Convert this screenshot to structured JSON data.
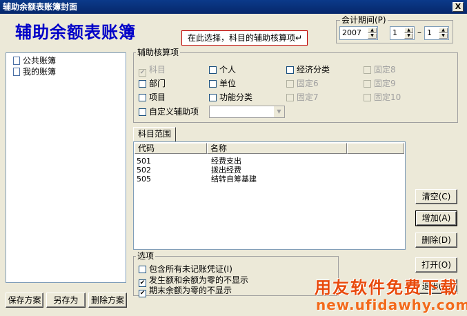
{
  "window": {
    "title": "辅助余额表账簿封面",
    "close_label": "X"
  },
  "heading": "辅助余额表账簿",
  "hint": "在此选择，科目的辅助核算项↵",
  "period": {
    "label": "会计期间(P)",
    "year": "2007",
    "from_month": "1",
    "separator": "–",
    "to_month": "1"
  },
  "tree": {
    "items": [
      "公共账簿",
      "我的账簿"
    ]
  },
  "aux": {
    "legend": "辅助核算项",
    "options": [
      {
        "label": "科目",
        "checked": true,
        "disabled": true
      },
      {
        "label": "个人",
        "checked": false,
        "disabled": false
      },
      {
        "label": "经济分类",
        "checked": false,
        "disabled": false
      },
      {
        "label": "固定8",
        "checked": false,
        "disabled": true
      },
      {
        "label": "部门",
        "checked": false,
        "disabled": false
      },
      {
        "label": "单位",
        "checked": false,
        "disabled": false
      },
      {
        "label": "固定6",
        "checked": false,
        "disabled": true
      },
      {
        "label": "固定9",
        "checked": false,
        "disabled": true
      },
      {
        "label": "项目",
        "checked": false,
        "disabled": false
      },
      {
        "label": "功能分类",
        "checked": false,
        "disabled": false
      },
      {
        "label": "固定7",
        "checked": false,
        "disabled": true
      },
      {
        "label": "固定10",
        "checked": false,
        "disabled": true
      },
      {
        "label": "自定义辅助项",
        "checked": false,
        "disabled": false
      }
    ],
    "custom_select_value": ""
  },
  "tab": {
    "label": "科目范围"
  },
  "subject_table": {
    "columns": [
      "代码",
      "名称"
    ],
    "rows": [
      {
        "code": "501",
        "name": "经费支出"
      },
      {
        "code": "502",
        "name": "拨出经费"
      },
      {
        "code": "505",
        "name": "结转自筹基建"
      }
    ]
  },
  "right_buttons": {
    "clear": "清空(C)",
    "add": "增加(A)",
    "delete": "删除(D)",
    "open": "打开(O)",
    "exit": "退出(X)"
  },
  "options": {
    "legend": "选项",
    "items": [
      {
        "label": "包含所有未记账凭证(I)",
        "checked": false
      },
      {
        "label": "发生额和余额为零的不显示",
        "checked": true
      },
      {
        "label": "期末余额为零的不显示",
        "checked": true
      }
    ]
  },
  "bottom_buttons": {
    "save": "保存方案",
    "save_as": "另存为",
    "delete_plan": "删除方案"
  },
  "watermark": {
    "line1": "用友软件免费下载",
    "line2": "new.ufidawhy.com"
  },
  "colors": {
    "title_bar": "#0b3a8a",
    "heading": "#0000c8",
    "hint_border": "#c00000",
    "watermark": "#e84a0c"
  }
}
